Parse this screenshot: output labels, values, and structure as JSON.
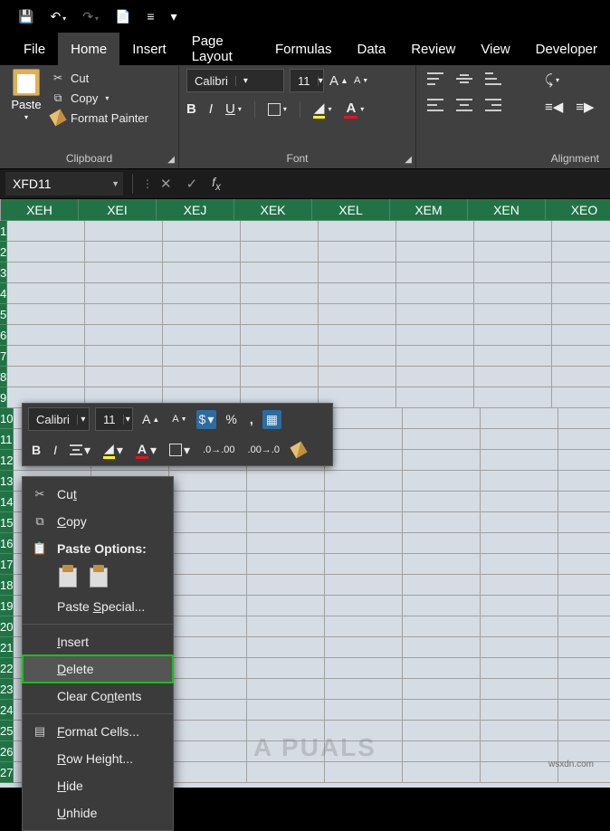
{
  "qat": {
    "save": "💾",
    "undo": "↶",
    "redo": "↷",
    "touch": "📄",
    "custom": "≡"
  },
  "tabs": [
    "File",
    "Home",
    "Insert",
    "Page Layout",
    "Formulas",
    "Data",
    "Review",
    "View",
    "Developer"
  ],
  "active_tab": 1,
  "clipboard": {
    "paste": "Paste",
    "cut": "Cut",
    "copy": "Copy",
    "painter": "Format Painter",
    "label": "Clipboard"
  },
  "font": {
    "name": "Calibri",
    "size": "11",
    "label": "Font"
  },
  "alignment": {
    "label": "Alignment"
  },
  "namebox": "XFD11",
  "columns": [
    "XEH",
    "XEI",
    "XEJ",
    "XEK",
    "XEL",
    "XEM",
    "XEN",
    "XEO"
  ],
  "rowcount": 27,
  "mini": {
    "font": "Calibri",
    "size": "11"
  },
  "context": {
    "cut": "Cut",
    "copy": "Copy",
    "paste_options": "Paste Options:",
    "paste_special": "Paste Special...",
    "insert": "Insert",
    "delete": "Delete",
    "clear": "Clear Contents",
    "format": "Format Cells...",
    "rowh": "Row Height...",
    "hide": "Hide",
    "unhide": "Unhide"
  },
  "watermark": "wsxdn.com",
  "logo": "A PUALS"
}
